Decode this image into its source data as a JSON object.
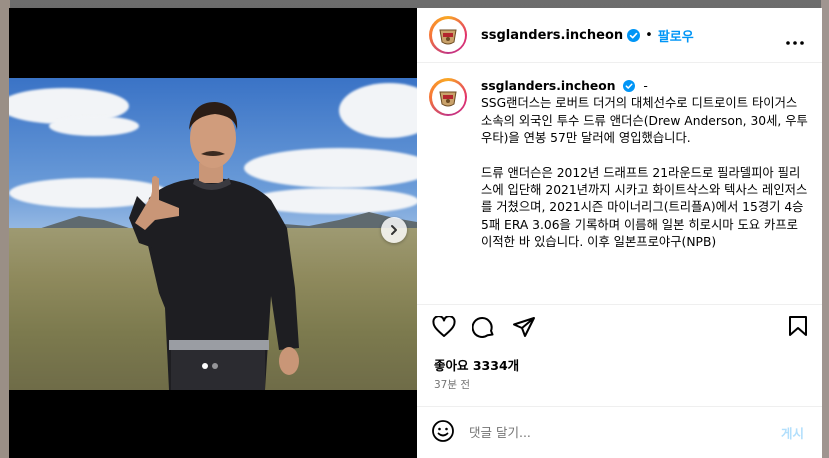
{
  "post": {
    "username": "ssglanders.incheon",
    "separator": "•",
    "follow_label": "팔로우",
    "caption_dash": "-",
    "caption_paragraph_1": "SSG랜더스는 로버트 더거의 대체선수로 디트로이트 타이거스 소속의 외국인 투수 드류 앤더슨(Drew Anderson, 30세, 우투우타)을 연봉 57만 달러에 영입했습니다.",
    "caption_paragraph_2": "드류 앤더슨은 2012년 드래프트 21라운드로 필라델피아 필리스에 입단해 2021년까지 시카고 화이트삭스와 텍사스 레인저스를 거쳤으며, 2021시즌 마이너리그(트리플A)에서 15경기 4승 5패 ERA 3.06을 기록하며 이름해 일본 히로시마 도요 카프로 이적한 바 있습니다. 이후 일본프로야구(NPB)",
    "likes_label": "좋아요 3334개",
    "time_label": "37분 전",
    "comment_placeholder": "댓글 달기...",
    "post_button": "게시"
  },
  "carousel": {
    "total": 2,
    "current": 1
  },
  "icons": {
    "header_more": "more-horizontal-icon",
    "verified": "verified-badge-icon",
    "like": "heart-icon",
    "comment": "comment-icon",
    "share": "share-icon",
    "save": "bookmark-icon",
    "emoji": "emoji-icon",
    "next": "chevron-right-icon"
  },
  "colors": {
    "accent": "#0095f6",
    "verified": "#0095f6",
    "post_disabled": "#b2dffc",
    "secondary_text": "#737373"
  }
}
